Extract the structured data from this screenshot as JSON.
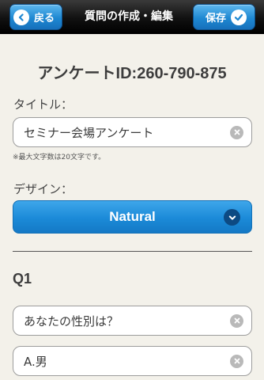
{
  "header": {
    "back_label": "戻る",
    "title": "質問の作成・編集",
    "save_label": "保存"
  },
  "survey": {
    "id_text": "アンケートID:260-790-875"
  },
  "title_section": {
    "label": "タイトル：",
    "value": "セミナー会場アンケート",
    "hint": "※最大文字数は20文字です。"
  },
  "design_section": {
    "label": "デザイン：",
    "selected": "Natural"
  },
  "question": {
    "label": "Q1",
    "text": "あなたの性別は？",
    "answers": [
      "A.男"
    ]
  },
  "colors": {
    "accent": "#1b8ad8",
    "header": "#111111",
    "background": "#f3f1ea"
  }
}
